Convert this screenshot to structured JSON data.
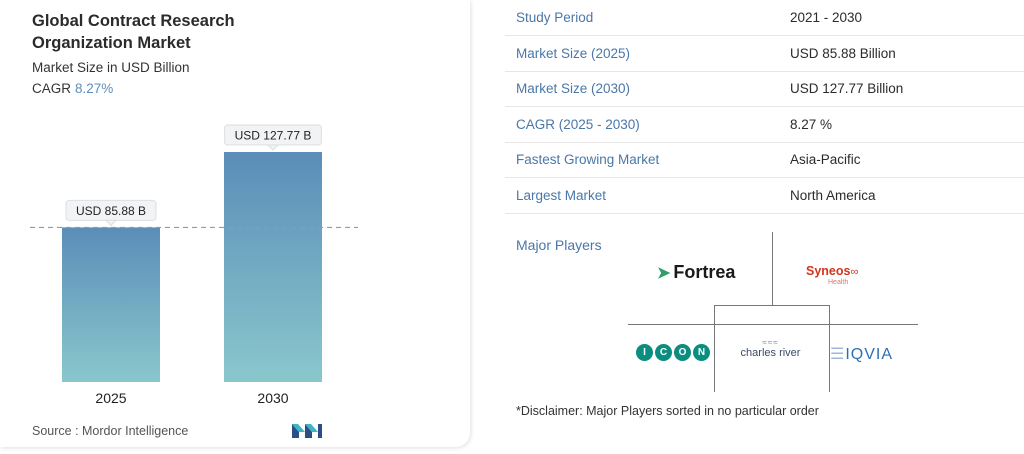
{
  "title": "Global Contract Research Organization Market",
  "subtitle": "Market Size in USD Billion",
  "cagr_label": "CAGR",
  "cagr_value": "8.27%",
  "source": "Source : Mordor Intelligence",
  "chart_data": {
    "type": "bar",
    "categories": [
      "2025",
      "2030"
    ],
    "values": [
      85.88,
      127.77
    ],
    "data_labels": [
      "USD 85.88 B",
      "USD 127.77 B"
    ],
    "ylim": [
      0,
      140
    ],
    "reference_line": 85.88,
    "grid": false,
    "colors": {
      "bar_top": "#5b8db8",
      "bar_bottom": "#8ac7cc",
      "line": "#6fa3c9"
    }
  },
  "table": [
    {
      "key": "Study Period",
      "value": "2021 - 2030"
    },
    {
      "key": "Market Size (2025)",
      "value": "USD 85.88 Billion"
    },
    {
      "key": "Market Size (2030)",
      "value": "USD 127.77 Billion"
    },
    {
      "key": "CAGR (2025 - 2030)",
      "value": "8.27 %"
    },
    {
      "key": "Fastest Growing Market",
      "value": "Asia-Pacific"
    },
    {
      "key": "Largest Market",
      "value": "North America"
    }
  ],
  "major_players_title": "Major Players",
  "players": {
    "fortrea": "Fortrea",
    "syneos": "Syneos",
    "syneos_sub": "Health",
    "icon_letters": [
      "I",
      "C",
      "O",
      "N"
    ],
    "charles_river": "charles river",
    "iqvia": "IQVIA"
  },
  "disclaimer": "*Disclaimer: Major Players sorted in no particular order"
}
